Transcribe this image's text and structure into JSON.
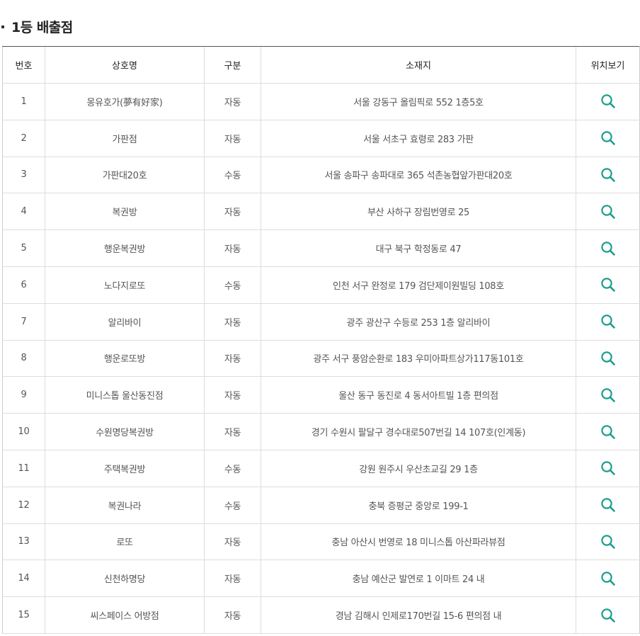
{
  "page": {
    "title": "1등 배출점"
  },
  "table": {
    "headers": [
      "번호",
      "상호명",
      "구분",
      "소재지",
      "위치보기"
    ],
    "rows": [
      {
        "no": "1",
        "name": "몽유호가(夢有好家)",
        "type": "자동",
        "address": "서울 강동구 올림픽로 552 1층5호"
      },
      {
        "no": "2",
        "name": "가판점",
        "type": "자동",
        "address": "서울 서초구 효령로 283 가판"
      },
      {
        "no": "3",
        "name": "가판대20호",
        "type": "수동",
        "address": "서울 송파구 송파대로 365 석촌농협앞가판대20호"
      },
      {
        "no": "4",
        "name": "복권방",
        "type": "자동",
        "address": "부산 사하구 장림번영로 25"
      },
      {
        "no": "5",
        "name": "행운복권방",
        "type": "자동",
        "address": "대구 북구 학정동로 47"
      },
      {
        "no": "6",
        "name": "노다지로또",
        "type": "수동",
        "address": "인천 서구 완정로 179 검단제이원빌딩 108호"
      },
      {
        "no": "7",
        "name": "알리바이",
        "type": "자동",
        "address": "광주 광산구 수등로 253 1층 알리바이"
      },
      {
        "no": "8",
        "name": "행운로또방",
        "type": "자동",
        "address": "광주 서구 풍암순환로 183 우미아파트상가117동101호"
      },
      {
        "no": "9",
        "name": "미니스톱 울산동진점",
        "type": "자동",
        "address": "울산 동구 동진로 4 동서아트빌 1층 편의점"
      },
      {
        "no": "10",
        "name": "수원명당복권방",
        "type": "자동",
        "address": "경기 수원시 팔달구 경수대로507번길 14 107호(인계동)"
      },
      {
        "no": "11",
        "name": "주택복권방",
        "type": "수동",
        "address": "강원 원주시 우산초교길 29 1층"
      },
      {
        "no": "12",
        "name": "복권나라",
        "type": "수동",
        "address": "충북 증평군 중앙로 199-1"
      },
      {
        "no": "13",
        "name": "로또",
        "type": "자동",
        "address": "충남 아산시 번영로 18 미니스톱 아산파라뷰점"
      },
      {
        "no": "14",
        "name": "신천하명당",
        "type": "자동",
        "address": "충남 예산군 발연로 1 이마트 24 내"
      },
      {
        "no": "15",
        "name": "씨스페이스 어방점",
        "type": "자동",
        "address": "경남 김해시 인제로170번길 15-6 편의점 내"
      }
    ]
  },
  "icons": {
    "location": "search-icon"
  },
  "colors": {
    "accent": "#1b9e8c",
    "text": "#555555",
    "header_text": "#222222",
    "border": "#dddddd",
    "top_border": "#555555"
  }
}
